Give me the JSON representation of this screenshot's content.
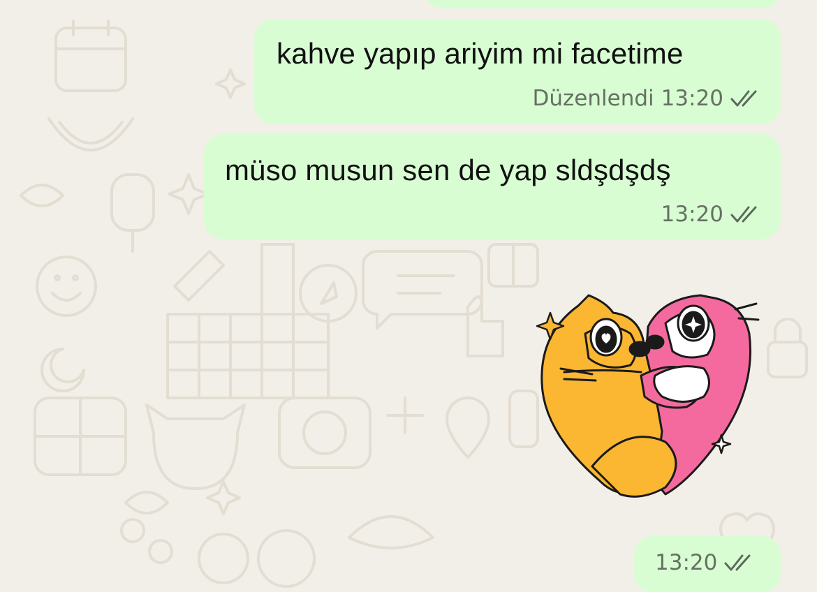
{
  "chat": {
    "messages": [
      {
        "text": "kahve yapıp ariyim mi facetime",
        "edited_label": "Düzenlendi",
        "time": "13:20",
        "status_icon": "double-check-icon"
      },
      {
        "text": "müso musun sen de yap sldşdşdş",
        "time": "13:20",
        "status_icon": "double-check-icon"
      }
    ],
    "sticker": {
      "icon": "cats-hugging-heart-sticker",
      "time": "13:20",
      "status_icon": "double-check-icon"
    }
  },
  "colors": {
    "outgoing_bubble": "#d9fdd3",
    "wallpaper": "#f2efe9",
    "doodle": "#e3ddd2",
    "meta_text": "#667063",
    "orange_cat": "#fbb731",
    "pink_cat": "#f56a9e"
  }
}
